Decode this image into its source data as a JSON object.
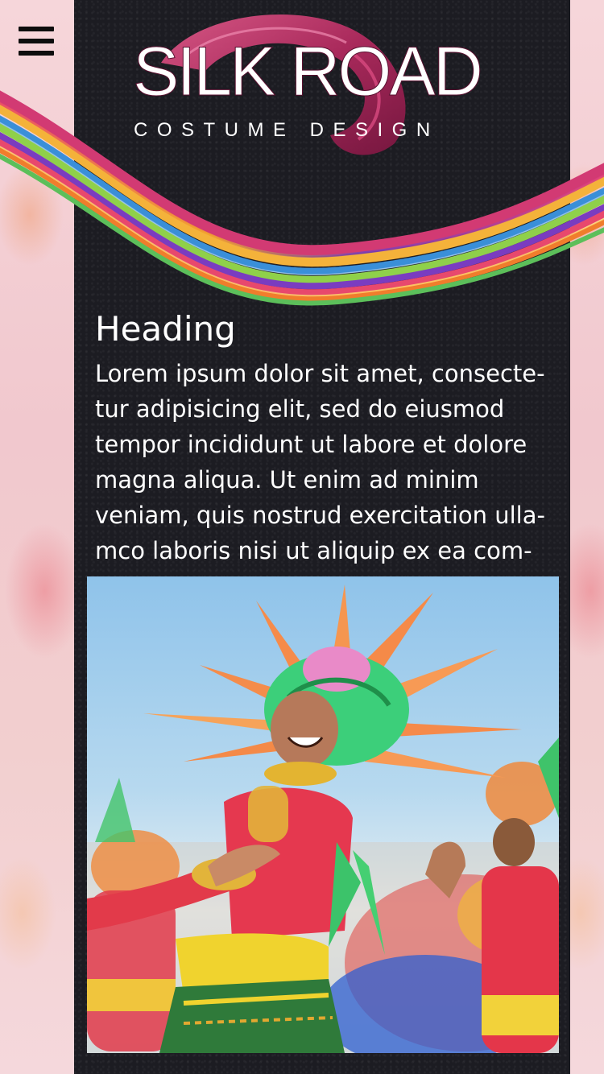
{
  "header": {
    "menu_icon": "hamburger-menu-icon",
    "logo": {
      "title": "SILK ROAD",
      "subtitle": "COSTUME DESIGN"
    }
  },
  "article": {
    "heading": "Heading",
    "body": "Lorem ipsum dolor sit amet, consecte-tur adipisicing elit, sed do eiusmod tempor incididunt ut labore et dolore magna aliqua. Ut enim ad minim veniam, quis nostrud exercitation ulla-mco laboris nisi ut aliquip ex ea com-"
  },
  "colors": {
    "panel": "#1c1c22",
    "side": "#f3d1d6",
    "logo_accent": "#c23a6e",
    "text": "#ffffff"
  }
}
